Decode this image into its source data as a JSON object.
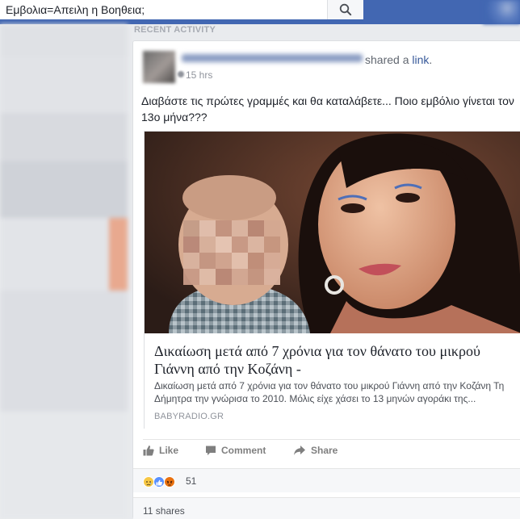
{
  "search": {
    "value": "Εμβολια=Απειλη η Βοηθεια;"
  },
  "feed": {
    "section_label": "RECENT ACTIVITY"
  },
  "post": {
    "shared_prefix": "shared a ",
    "shared_link": "link",
    "shared_suffix": ".",
    "timestamp": "15 hrs",
    "text": "Διαβάστε τις πρώτες γραμμές και θα καταλάβετε... Ποιο εμβόλιο γίνεται τον 13ο μήνα???",
    "link_preview": {
      "title": "Δικαίωση μετά από 7 χρόνια για τον θάνατο του μικρού Γιάννη από την Κοζάνη -",
      "description": "Δικαίωση μετά από 7 χρόνια για τον θάνατο του μικρού Γιάννη από την Κοζάνη Τη Δήμητρα την γνώρισα το 2010. Μόλις είχε χάσει το 13 μηνών αγοράκι της...",
      "domain": "BABYRADIO.GR"
    },
    "actions": {
      "like": "Like",
      "comment": "Comment",
      "share": "Share"
    },
    "reactions": {
      "count": "51",
      "types": [
        "sad-icon",
        "like-icon",
        "angry-icon"
      ]
    },
    "shares": "11 shares"
  },
  "colors": {
    "brand": "#4267b2",
    "link": "#365899"
  }
}
